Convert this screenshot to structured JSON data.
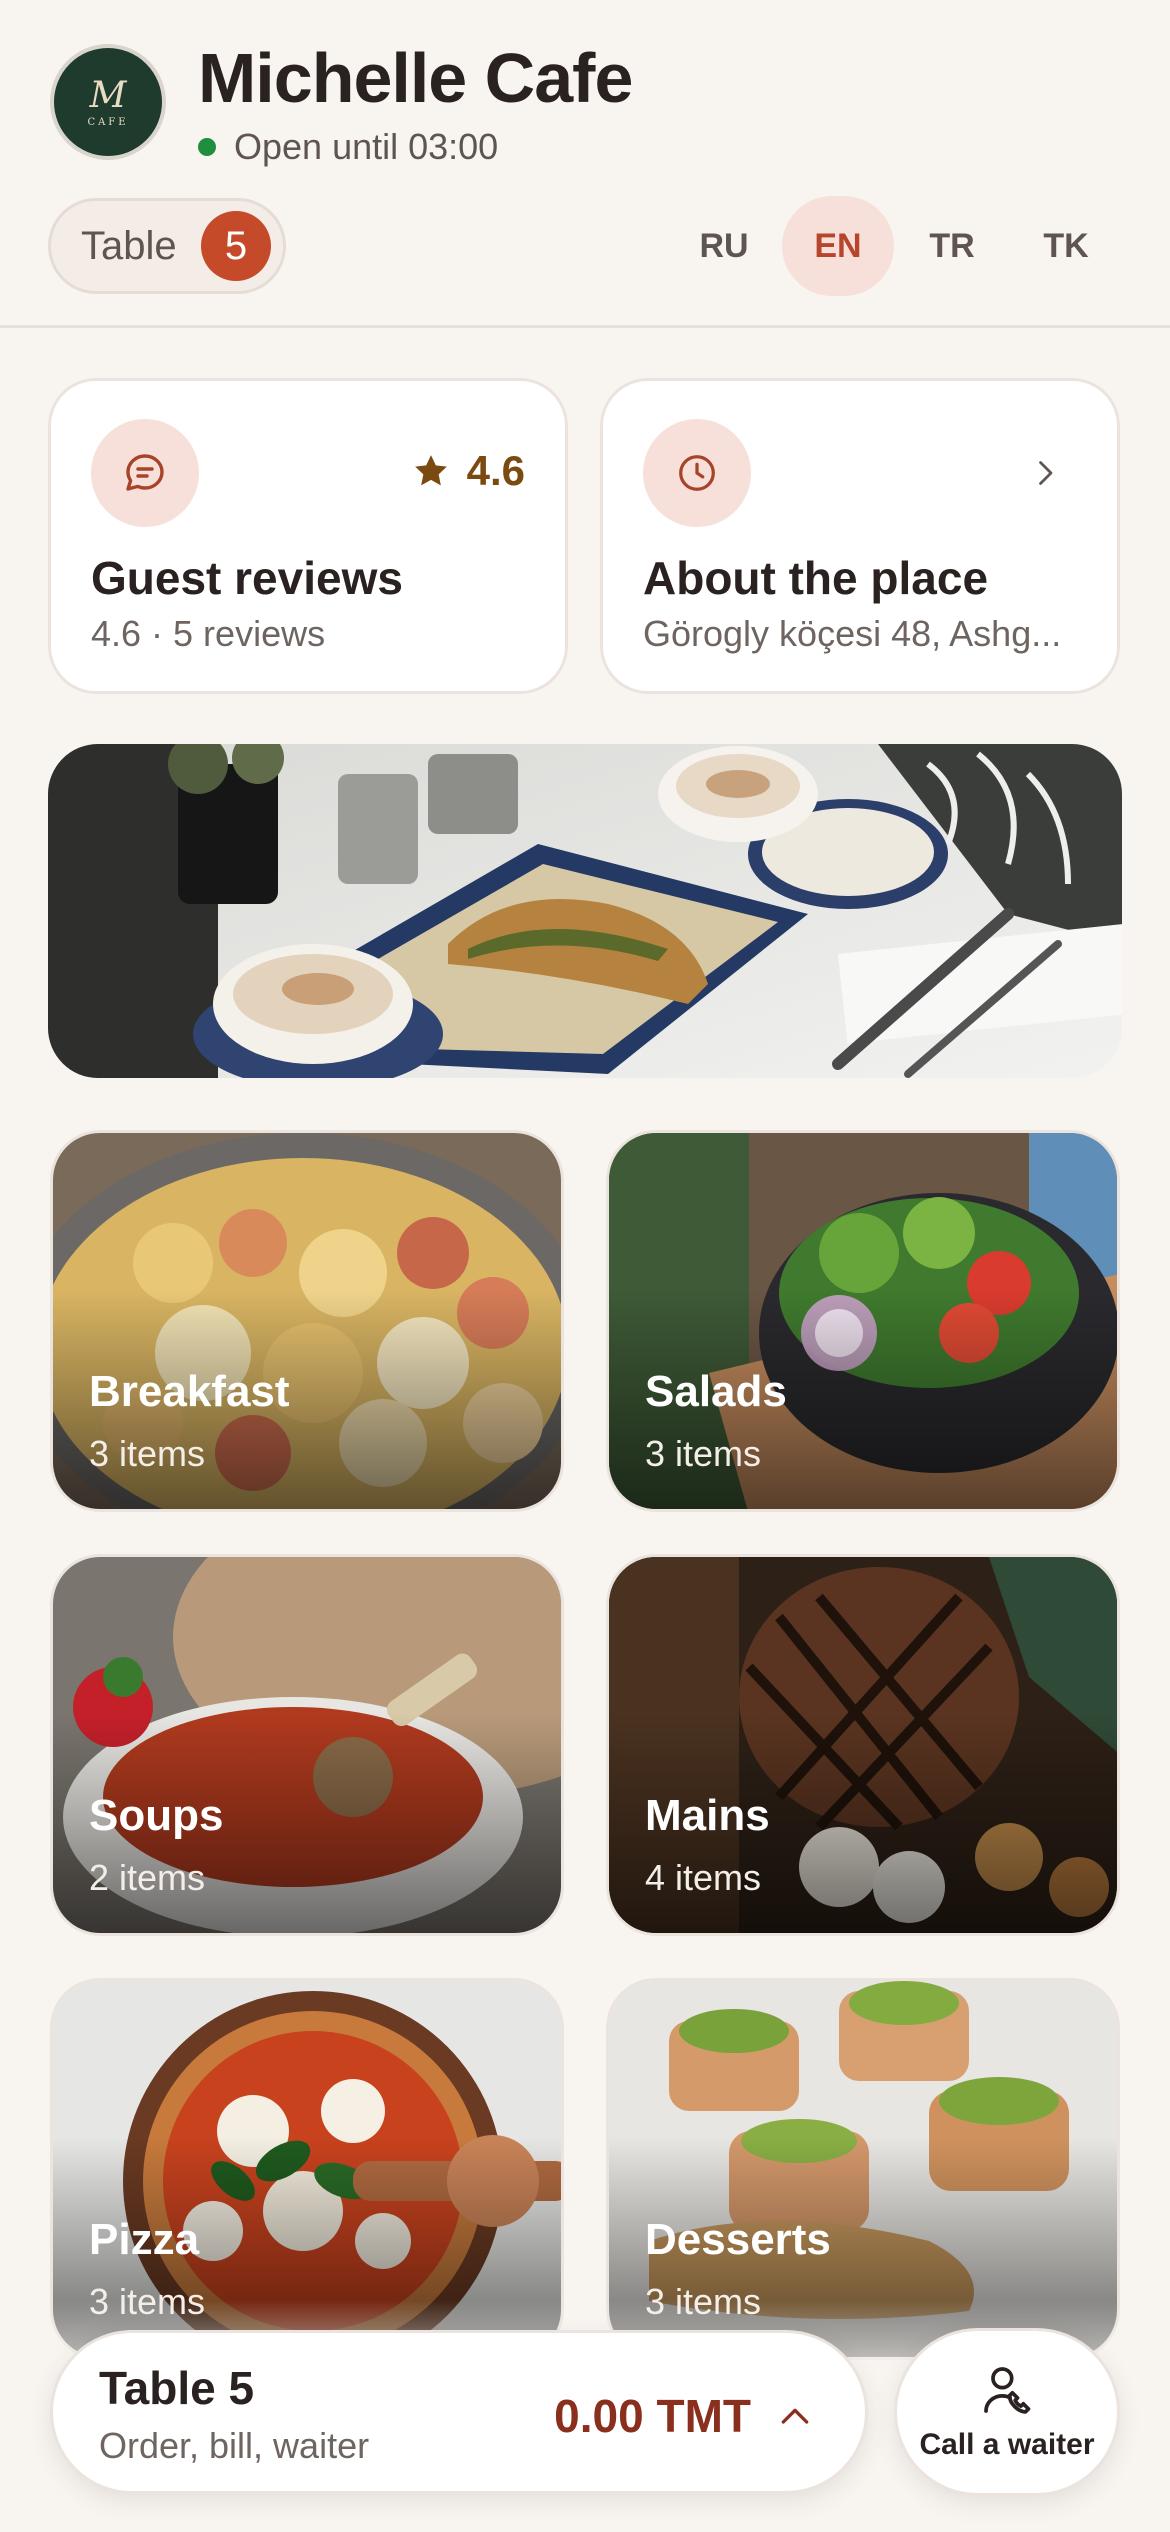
{
  "header": {
    "logo_letter": "M",
    "logo_sub": "CAFE",
    "cafe_name": "Michelle Cafe",
    "status": "Open until 03:00",
    "status_color": "#1f8f3e",
    "table_label": "Table",
    "table_number": "5",
    "languages": [
      {
        "code": "RU",
        "active": false
      },
      {
        "code": "EN",
        "active": true
      },
      {
        "code": "TR",
        "active": false
      },
      {
        "code": "TK",
        "active": false
      }
    ]
  },
  "info_cards": {
    "reviews": {
      "icon": "chat-bubble-icon",
      "rating": "4.6",
      "title": "Guest reviews",
      "subtitle": "4.6 · 5 reviews"
    },
    "about": {
      "icon": "clock-icon",
      "title": "About the place",
      "subtitle": "Görogly köçesi 48, Ashg..."
    }
  },
  "hero": {
    "image": "coffee-and-baklava-photo"
  },
  "categories": [
    {
      "name": "Breakfast",
      "count": "3 items",
      "image": "scrambled-eggs-photo"
    },
    {
      "name": "Salads",
      "count": "3 items",
      "image": "salad-bowl-photo"
    },
    {
      "name": "Soups",
      "count": "2 items",
      "image": "soup-bowl-photo"
    },
    {
      "name": "Mains",
      "count": "4 items",
      "image": "grilled-steak-photo"
    },
    {
      "name": "Pizza",
      "count": "3 items",
      "image": "pizza-photo"
    },
    {
      "name": "Desserts",
      "count": "3 items",
      "image": "baklava-photo"
    }
  ],
  "order_bar": {
    "title": "Table 5",
    "subtitle": "Order, bill, waiter",
    "total": "0.00 TMT"
  },
  "call_waiter": {
    "label": "Call a waiter",
    "icon": "person-phone-icon"
  },
  "colors": {
    "background": "#f8f5f1",
    "accent": "#c54a2a",
    "accent_soft": "#f7e0da",
    "total_text": "#8a2e1e",
    "rating_text": "#7a4a10"
  }
}
